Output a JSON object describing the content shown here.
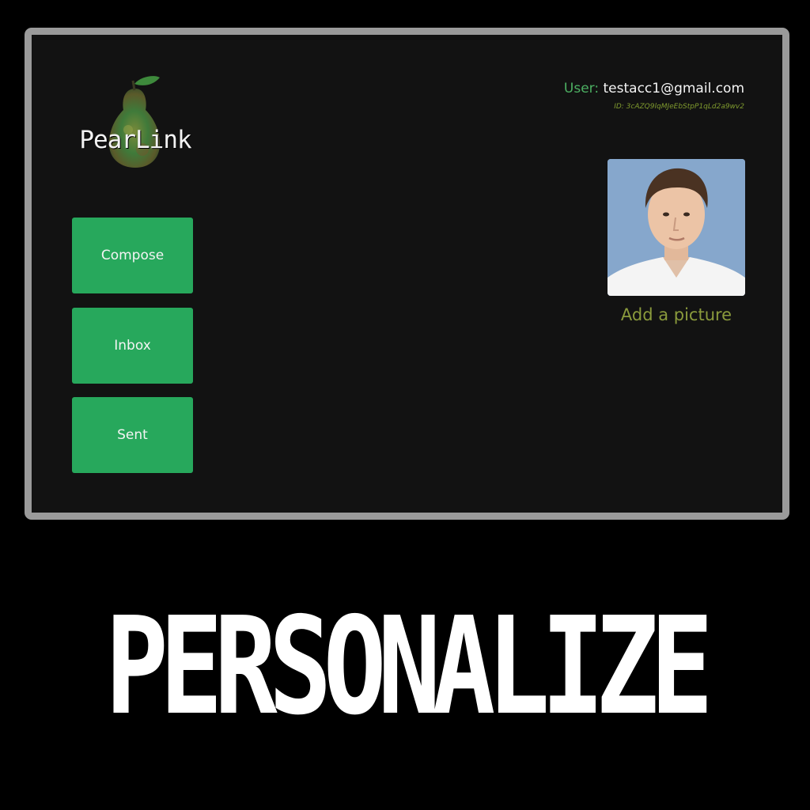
{
  "app": {
    "logo_text": "PearLink"
  },
  "nav": {
    "items": [
      {
        "id": "compose",
        "label": "Compose"
      },
      {
        "id": "inbox",
        "label": "Inbox"
      },
      {
        "id": "sent",
        "label": "Sent"
      }
    ]
  },
  "user": {
    "label": "User:",
    "email": "testacc1@gmail.com",
    "id_text": "ID: 3cAZQ9lqMJeEbStpP1qLd2a9wv2"
  },
  "profile": {
    "add_picture_label": "Add a picture"
  },
  "headline": "PERSONALIZE",
  "colors": {
    "accent": "#27a85c",
    "label_green": "#4caf62",
    "olive": "#8a9a3c"
  }
}
